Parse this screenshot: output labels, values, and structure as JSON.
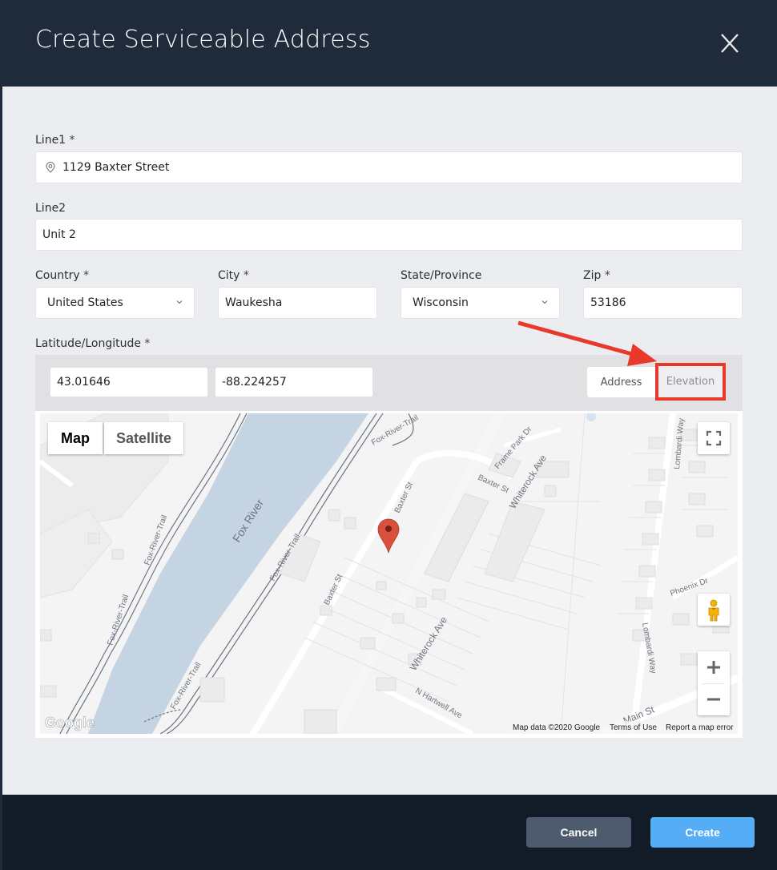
{
  "header": {
    "title": "Create Serviceable Address",
    "close_icon": "close-icon"
  },
  "form": {
    "line1": {
      "label": "Line1",
      "required_mark": "*",
      "value": "1129 Baxter Street",
      "icon": "location-pin-icon"
    },
    "line2": {
      "label": "Line2",
      "value": "Unit 2"
    },
    "country": {
      "label": "Country",
      "required_mark": "*",
      "selected": "United States"
    },
    "city": {
      "label": "City",
      "required_mark": "*",
      "value": "Waukesha"
    },
    "state": {
      "label": "State/Province",
      "selected": "Wisconsin"
    },
    "zip": {
      "label": "Zip",
      "required_mark": "*",
      "value": "53186"
    },
    "latlng": {
      "label": "Latitude/Longitude",
      "required_mark": "*",
      "latitude": "43.01646",
      "longitude": "-88.224257",
      "toggle": {
        "address_label": "Address",
        "elevation_label": "Elevation"
      }
    }
  },
  "map": {
    "map_type": {
      "map_label": "Map",
      "satellite_label": "Satellite",
      "selected": "Map"
    },
    "labels": {
      "river": "Fox River",
      "trail": "Fox-River-Trail",
      "baxter": "Baxter St",
      "whiterock": "Whiterock Ave",
      "frame_park": "Frame Park Dr",
      "lombardi": "Lombardi Way",
      "phoenix": "Phoenix Dr",
      "hartwell": "N Hartwell Ave",
      "main": "Main St"
    },
    "logo": "Google",
    "attribution": {
      "data": "Map data ©2020 Google",
      "terms": "Terms of Use",
      "report": "Report a map error"
    },
    "colors": {
      "water": "#c5d4e3",
      "land": "#f4f4f4",
      "road": "#ffffff",
      "marker": "#d9503c",
      "trail": "#6b7583"
    }
  },
  "annotation": {
    "color": "#e8392a",
    "target": "Elevation"
  },
  "footer": {
    "cancel_label": "Cancel",
    "create_label": "Create"
  },
  "colors": {
    "header_bg": "#1f2a3a",
    "footer_bg": "#121c29",
    "body_bg": "#ecedf1",
    "primary": "#55aef5",
    "secondary": "#4e5b6e"
  }
}
